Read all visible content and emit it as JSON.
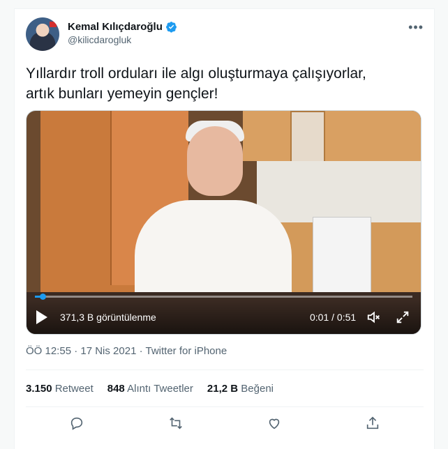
{
  "tweet": {
    "display_name": "Kemal Kılıçdaroğlu",
    "handle": "@kilicdarogluk",
    "text_line1": "Yıllardır troll orduları ile algı oluşturmaya çalışıyorlar,",
    "text_line2": "artık bunları yemeyin gençler!",
    "timestamp": "ÖÖ 12:55 · 17 Nis 2021 · Twitter for iPhone"
  },
  "video": {
    "views": "371,3 B görüntülenme",
    "time": "0:01 / 0:51",
    "progress_fraction": 0.02
  },
  "stats": {
    "retweets_count": "3.150",
    "retweets_label": "Retweet",
    "quotes_count": "848",
    "quotes_label": "Alıntı Tweetler",
    "likes_count": "21,2 B",
    "likes_label": "Beğeni"
  },
  "icons": {
    "verified": "verified-badge-icon",
    "more": "more-options-icon",
    "play": "play-icon",
    "volume": "volume-icon",
    "fullscreen": "fullscreen-icon",
    "reply": "reply-icon",
    "retweet": "retweet-icon",
    "like": "like-icon",
    "share": "share-icon"
  },
  "colors": {
    "accent": "#1d9bf0",
    "text": "#0f1419",
    "muted": "#536471"
  }
}
